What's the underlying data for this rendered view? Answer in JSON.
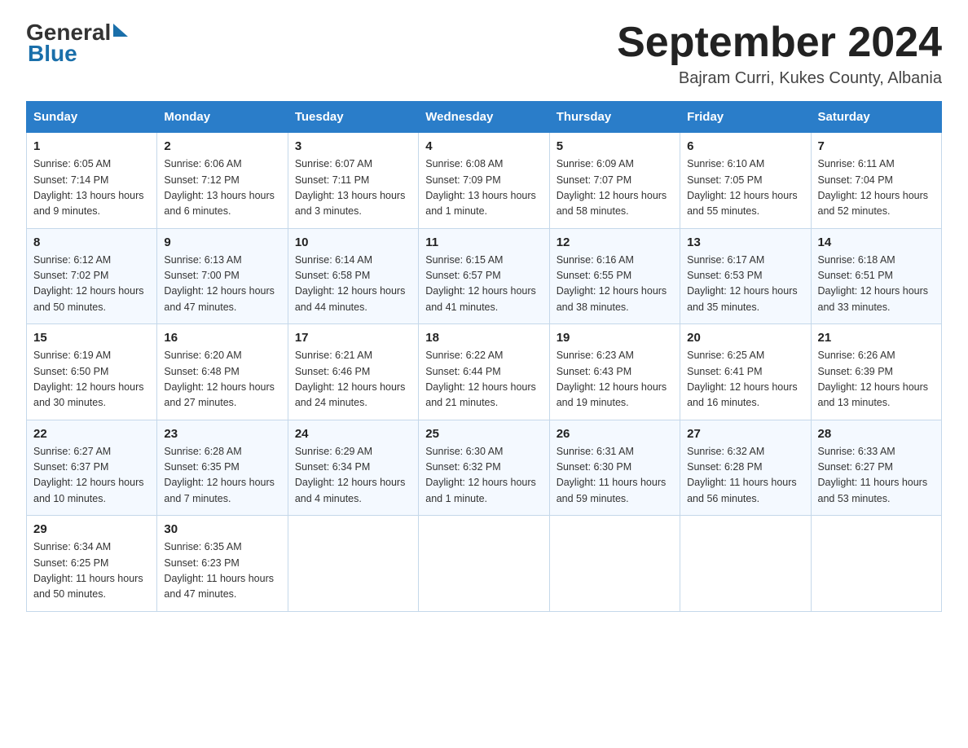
{
  "logo": {
    "part1": "General",
    "part2": "Blue"
  },
  "title": "September 2024",
  "subtitle": "Bajram Curri, Kukes County, Albania",
  "days_header": [
    "Sunday",
    "Monday",
    "Tuesday",
    "Wednesday",
    "Thursday",
    "Friday",
    "Saturday"
  ],
  "weeks": [
    [
      {
        "date": "1",
        "sunrise": "6:05 AM",
        "sunset": "7:14 PM",
        "daylight": "13 hours and 9 minutes."
      },
      {
        "date": "2",
        "sunrise": "6:06 AM",
        "sunset": "7:12 PM",
        "daylight": "13 hours and 6 minutes."
      },
      {
        "date": "3",
        "sunrise": "6:07 AM",
        "sunset": "7:11 PM",
        "daylight": "13 hours and 3 minutes."
      },
      {
        "date": "4",
        "sunrise": "6:08 AM",
        "sunset": "7:09 PM",
        "daylight": "13 hours and 1 minute."
      },
      {
        "date": "5",
        "sunrise": "6:09 AM",
        "sunset": "7:07 PM",
        "daylight": "12 hours and 58 minutes."
      },
      {
        "date": "6",
        "sunrise": "6:10 AM",
        "sunset": "7:05 PM",
        "daylight": "12 hours and 55 minutes."
      },
      {
        "date": "7",
        "sunrise": "6:11 AM",
        "sunset": "7:04 PM",
        "daylight": "12 hours and 52 minutes."
      }
    ],
    [
      {
        "date": "8",
        "sunrise": "6:12 AM",
        "sunset": "7:02 PM",
        "daylight": "12 hours and 50 minutes."
      },
      {
        "date": "9",
        "sunrise": "6:13 AM",
        "sunset": "7:00 PM",
        "daylight": "12 hours and 47 minutes."
      },
      {
        "date": "10",
        "sunrise": "6:14 AM",
        "sunset": "6:58 PM",
        "daylight": "12 hours and 44 minutes."
      },
      {
        "date": "11",
        "sunrise": "6:15 AM",
        "sunset": "6:57 PM",
        "daylight": "12 hours and 41 minutes."
      },
      {
        "date": "12",
        "sunrise": "6:16 AM",
        "sunset": "6:55 PM",
        "daylight": "12 hours and 38 minutes."
      },
      {
        "date": "13",
        "sunrise": "6:17 AM",
        "sunset": "6:53 PM",
        "daylight": "12 hours and 35 minutes."
      },
      {
        "date": "14",
        "sunrise": "6:18 AM",
        "sunset": "6:51 PM",
        "daylight": "12 hours and 33 minutes."
      }
    ],
    [
      {
        "date": "15",
        "sunrise": "6:19 AM",
        "sunset": "6:50 PM",
        "daylight": "12 hours and 30 minutes."
      },
      {
        "date": "16",
        "sunrise": "6:20 AM",
        "sunset": "6:48 PM",
        "daylight": "12 hours and 27 minutes."
      },
      {
        "date": "17",
        "sunrise": "6:21 AM",
        "sunset": "6:46 PM",
        "daylight": "12 hours and 24 minutes."
      },
      {
        "date": "18",
        "sunrise": "6:22 AM",
        "sunset": "6:44 PM",
        "daylight": "12 hours and 21 minutes."
      },
      {
        "date": "19",
        "sunrise": "6:23 AM",
        "sunset": "6:43 PM",
        "daylight": "12 hours and 19 minutes."
      },
      {
        "date": "20",
        "sunrise": "6:25 AM",
        "sunset": "6:41 PM",
        "daylight": "12 hours and 16 minutes."
      },
      {
        "date": "21",
        "sunrise": "6:26 AM",
        "sunset": "6:39 PM",
        "daylight": "12 hours and 13 minutes."
      }
    ],
    [
      {
        "date": "22",
        "sunrise": "6:27 AM",
        "sunset": "6:37 PM",
        "daylight": "12 hours and 10 minutes."
      },
      {
        "date": "23",
        "sunrise": "6:28 AM",
        "sunset": "6:35 PM",
        "daylight": "12 hours and 7 minutes."
      },
      {
        "date": "24",
        "sunrise": "6:29 AM",
        "sunset": "6:34 PM",
        "daylight": "12 hours and 4 minutes."
      },
      {
        "date": "25",
        "sunrise": "6:30 AM",
        "sunset": "6:32 PM",
        "daylight": "12 hours and 1 minute."
      },
      {
        "date": "26",
        "sunrise": "6:31 AM",
        "sunset": "6:30 PM",
        "daylight": "11 hours and 59 minutes."
      },
      {
        "date": "27",
        "sunrise": "6:32 AM",
        "sunset": "6:28 PM",
        "daylight": "11 hours and 56 minutes."
      },
      {
        "date": "28",
        "sunrise": "6:33 AM",
        "sunset": "6:27 PM",
        "daylight": "11 hours and 53 minutes."
      }
    ],
    [
      {
        "date": "29",
        "sunrise": "6:34 AM",
        "sunset": "6:25 PM",
        "daylight": "11 hours and 50 minutes."
      },
      {
        "date": "30",
        "sunrise": "6:35 AM",
        "sunset": "6:23 PM",
        "daylight": "11 hours and 47 minutes."
      },
      null,
      null,
      null,
      null,
      null
    ]
  ],
  "labels": {
    "sunrise": "Sunrise:",
    "sunset": "Sunset:",
    "daylight": "Daylight:"
  }
}
